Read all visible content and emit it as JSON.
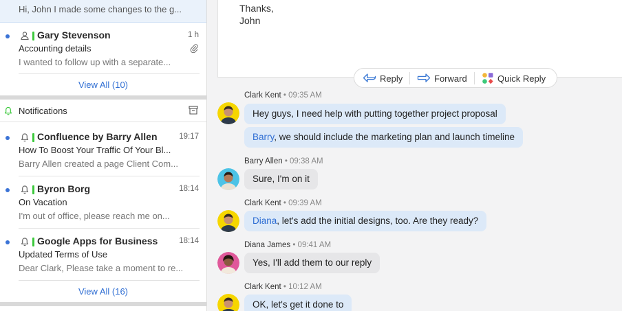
{
  "mail_list": {
    "selected_preview": "Hi, John I made some changes to the g...",
    "item": {
      "sender": "Gary Stevenson",
      "time": "1 h",
      "subject": "Accounting details",
      "preview": "I wanted to follow up with a separate...",
      "icons": {
        "kind": "person-icon",
        "attachment": "paperclip-icon"
      }
    },
    "view_all": "View All (10)"
  },
  "notifications": {
    "title": "Notifications",
    "icons": {
      "header": "bell-icon",
      "archive": "archive-icon"
    },
    "items": [
      {
        "sender": "Confluence by Barry Allen",
        "time": "19:17",
        "subject": "How To Boost Your Traffic Of Your Bl...",
        "preview": "Barry Allen created a page Client Com..."
      },
      {
        "sender": "Byron Borg",
        "time": "18:14",
        "subject": "On Vacation",
        "preview": "I'm out of office, please reach me on..."
      },
      {
        "sender": "Google Apps for Business",
        "time": "18:14",
        "subject": "Updated Terms of Use",
        "preview": "Dear Clark, Please take a moment to re..."
      }
    ],
    "view_all": "View All (16)"
  },
  "email_body": {
    "closing": "Thanks,",
    "signature": "John"
  },
  "actions": {
    "reply": "Reply",
    "forward": "Forward",
    "quick_reply": "Quick Reply",
    "icons": {
      "reply": "reply-arrow-icon",
      "forward": "forward-arrow-icon",
      "quick_reply": "emoji-shapes-icon"
    }
  },
  "chat": {
    "messages": [
      {
        "author": "Clark Kent",
        "time": "• 09:35 AM",
        "lines": [
          {
            "text": "Hey guys, I need help with putting together project proposal"
          },
          {
            "mention": "Barry",
            "text": ", we should include the marketing plan and launch timeline"
          }
        ]
      },
      {
        "author": "Barry Allen",
        "time": "• 09:38 AM",
        "lines": [
          {
            "text": "Sure, I'm on it"
          }
        ]
      },
      {
        "author": "Clark Kent",
        "time": "• 09:39 AM",
        "lines": [
          {
            "mention": "Diana",
            "text": ", let's add the initial designs, too. Are they ready?"
          }
        ]
      },
      {
        "author": "Diana James",
        "time": "• 09:41 AM",
        "lines": [
          {
            "text": "Yes, I'll add them to our reply"
          }
        ]
      },
      {
        "author": "Clark Kent",
        "time": "• 10:12 AM",
        "lines": [
          {
            "text": "OK, let's get it done to"
          }
        ]
      }
    ]
  },
  "colors": {
    "accent": "#2f6ed3",
    "unread_dot": "#3b73d6",
    "flag": "#3cc93c",
    "bubble_blue": "#dce9f8",
    "bubble_grey": "#e6e6e8"
  }
}
